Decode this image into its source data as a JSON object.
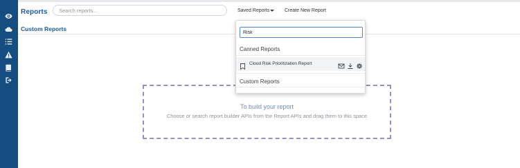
{
  "header": {
    "title": "Reports",
    "search_placeholder": "Search reports...",
    "saved_reports_label": "Saved Reports",
    "create_new_label": "Create New Report"
  },
  "sidebar": {
    "icons": [
      "eye-icon",
      "cloud-icon",
      "list-icon",
      "warning-icon",
      "book-icon",
      "logout-icon"
    ]
  },
  "section": {
    "title": "Custom Reports"
  },
  "dropdown": {
    "search_value": "Risk",
    "canned_heading": "Canned Reports",
    "canned_items": [
      {
        "label": "Cloud Risk Prioritization Report"
      }
    ],
    "custom_heading": "Custom Reports"
  },
  "dropzone": {
    "title": "To build your report",
    "subtitle": "Choose or search report builder APIs from the Report APIs and drag them to this space"
  },
  "colors": {
    "rail": "#164d80",
    "accent": "#1c5a96",
    "dropzone_border": "#8f91c2"
  }
}
